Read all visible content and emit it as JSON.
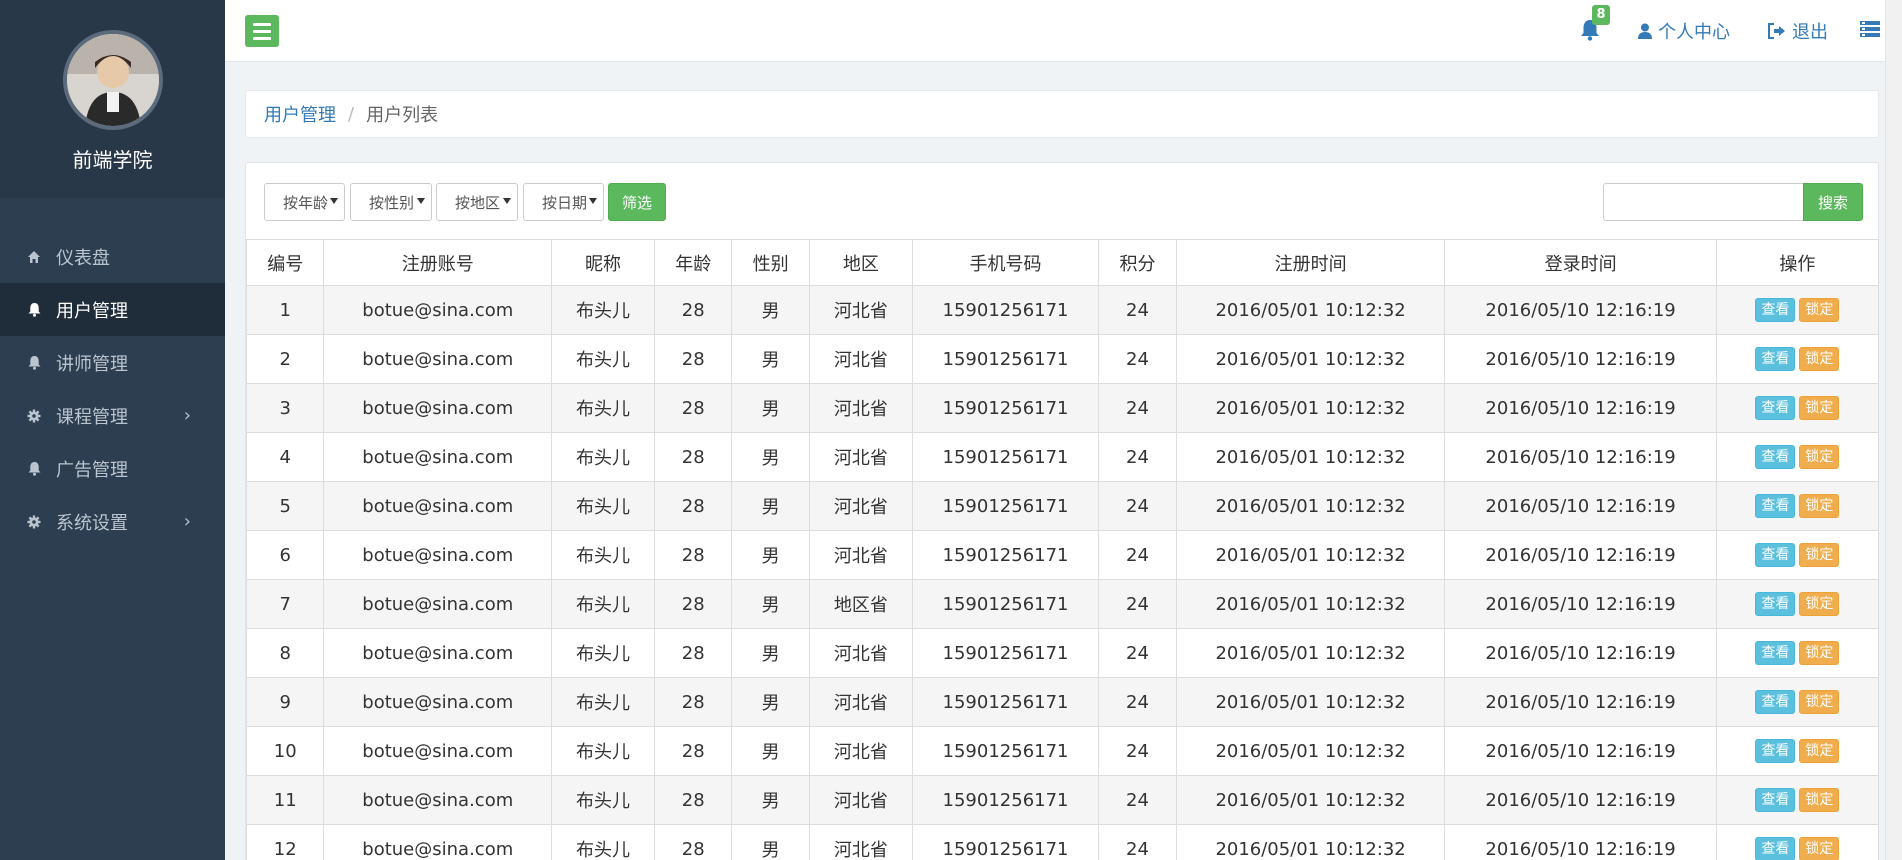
{
  "sidebar": {
    "site_name": "前端学院",
    "items": [
      {
        "label": "仪表盘",
        "icon": "home-icon",
        "active": false,
        "has_arrow": false
      },
      {
        "label": "用户管理",
        "icon": "bell-icon",
        "active": true,
        "has_arrow": false
      },
      {
        "label": "讲师管理",
        "icon": "bell-icon",
        "active": false,
        "has_arrow": false
      },
      {
        "label": "课程管理",
        "icon": "gear-icon",
        "active": false,
        "has_arrow": true
      },
      {
        "label": "广告管理",
        "icon": "bell-icon",
        "active": false,
        "has_arrow": false
      },
      {
        "label": "系统设置",
        "icon": "gear-icon",
        "active": false,
        "has_arrow": true
      }
    ],
    "arrow_glyph": "›"
  },
  "topbar": {
    "notification_count": "8",
    "profile_label": "个人中心",
    "logout_label": "退出"
  },
  "breadcrumb": {
    "parent": "用户管理",
    "separator": "/",
    "current": "用户列表"
  },
  "filters": {
    "age": "按年龄",
    "gender": "按性别",
    "region": "按地区",
    "date": "按日期",
    "filter_button": "筛选",
    "search_value": "",
    "search_button": "搜索"
  },
  "table": {
    "headers": [
      "编号",
      "注册账号",
      "昵称",
      "年龄",
      "性别",
      "地区",
      "手机号码",
      "积分",
      "注册时间",
      "登录时间",
      "操作"
    ],
    "view_label": "查看",
    "lock_label": "锁定",
    "rows": [
      {
        "id": "1",
        "account": "botue@sina.com",
        "nickname": "布头儿",
        "age": "28",
        "gender": "男",
        "region": "河北省",
        "phone": "15901256171",
        "points": "24",
        "registered": "2016/05/01 10:12:32",
        "login": "2016/05/10 12:16:19"
      },
      {
        "id": "2",
        "account": "botue@sina.com",
        "nickname": "布头儿",
        "age": "28",
        "gender": "男",
        "region": "河北省",
        "phone": "15901256171",
        "points": "24",
        "registered": "2016/05/01 10:12:32",
        "login": "2016/05/10 12:16:19"
      },
      {
        "id": "3",
        "account": "botue@sina.com",
        "nickname": "布头儿",
        "age": "28",
        "gender": "男",
        "region": "河北省",
        "phone": "15901256171",
        "points": "24",
        "registered": "2016/05/01 10:12:32",
        "login": "2016/05/10 12:16:19"
      },
      {
        "id": "4",
        "account": "botue@sina.com",
        "nickname": "布头儿",
        "age": "28",
        "gender": "男",
        "region": "河北省",
        "phone": "15901256171",
        "points": "24",
        "registered": "2016/05/01 10:12:32",
        "login": "2016/05/10 12:16:19"
      },
      {
        "id": "5",
        "account": "botue@sina.com",
        "nickname": "布头儿",
        "age": "28",
        "gender": "男",
        "region": "河北省",
        "phone": "15901256171",
        "points": "24",
        "registered": "2016/05/01 10:12:32",
        "login": "2016/05/10 12:16:19"
      },
      {
        "id": "6",
        "account": "botue@sina.com",
        "nickname": "布头儿",
        "age": "28",
        "gender": "男",
        "region": "河北省",
        "phone": "15901256171",
        "points": "24",
        "registered": "2016/05/01 10:12:32",
        "login": "2016/05/10 12:16:19"
      },
      {
        "id": "7",
        "account": "botue@sina.com",
        "nickname": "布头儿",
        "age": "28",
        "gender": "男",
        "region": "地区省",
        "phone": "15901256171",
        "points": "24",
        "registered": "2016/05/01 10:12:32",
        "login": "2016/05/10 12:16:19"
      },
      {
        "id": "8",
        "account": "botue@sina.com",
        "nickname": "布头儿",
        "age": "28",
        "gender": "男",
        "region": "河北省",
        "phone": "15901256171",
        "points": "24",
        "registered": "2016/05/01 10:12:32",
        "login": "2016/05/10 12:16:19"
      },
      {
        "id": "9",
        "account": "botue@sina.com",
        "nickname": "布头儿",
        "age": "28",
        "gender": "男",
        "region": "河北省",
        "phone": "15901256171",
        "points": "24",
        "registered": "2016/05/01 10:12:32",
        "login": "2016/05/10 12:16:19"
      },
      {
        "id": "10",
        "account": "botue@sina.com",
        "nickname": "布头儿",
        "age": "28",
        "gender": "男",
        "region": "河北省",
        "phone": "15901256171",
        "points": "24",
        "registered": "2016/05/01 10:12:32",
        "login": "2016/05/10 12:16:19"
      },
      {
        "id": "11",
        "account": "botue@sina.com",
        "nickname": "布头儿",
        "age": "28",
        "gender": "男",
        "region": "河北省",
        "phone": "15901256171",
        "points": "24",
        "registered": "2016/05/01 10:12:32",
        "login": "2016/05/10 12:16:19"
      },
      {
        "id": "12",
        "account": "botue@sina.com",
        "nickname": "布头儿",
        "age": "28",
        "gender": "男",
        "region": "河北省",
        "phone": "15901256171",
        "points": "24",
        "registered": "2016/05/01 10:12:32",
        "login": "2016/05/10 12:16:19"
      }
    ]
  },
  "colors": {
    "sidebar_bg": "#2d3e50",
    "primary_green": "#5cb85c",
    "link_blue": "#337ab7",
    "info_blue": "#5bc0de",
    "warning_orange": "#f0ad4e"
  }
}
